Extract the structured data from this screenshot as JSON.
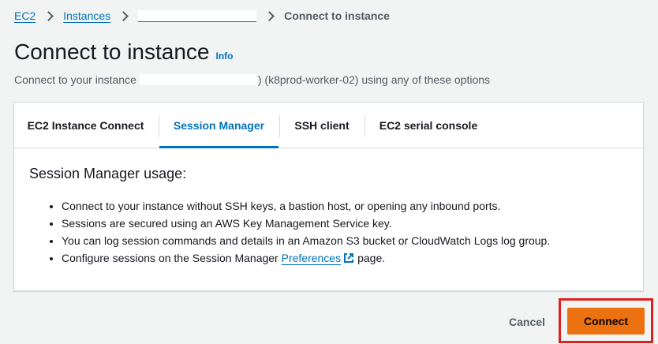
{
  "breadcrumb": {
    "items": [
      "EC2",
      "Instances"
    ],
    "current": "Connect to instance"
  },
  "header": {
    "title": "Connect to instance",
    "info": "Info",
    "subtitle_prefix": "Connect to your instance",
    "subtitle_suffix": ") (k8prod-worker-02) using any of these options"
  },
  "tabs": [
    {
      "label": "EC2 Instance Connect"
    },
    {
      "label": "Session Manager"
    },
    {
      "label": "SSH client"
    },
    {
      "label": "EC2 serial console"
    }
  ],
  "active_tab": "Session Manager",
  "panel": {
    "heading": "Session Manager usage:",
    "bullets": [
      "Connect to your instance without SSH keys, a bastion host, or opening any inbound ports.",
      "Sessions are secured using an AWS Key Management Service key.",
      "You can log session commands and details in an Amazon S3 bucket or CloudWatch Logs log group."
    ],
    "last_bullet": {
      "prefix": "Configure sessions on the Session Manager",
      "link": "Preferences",
      "suffix": "page."
    }
  },
  "footer": {
    "cancel": "Cancel",
    "connect": "Connect"
  },
  "colors": {
    "link": "#0073bb",
    "primary_button": "#ec7211",
    "highlight": "#e02020",
    "background": "#f2f3f3"
  }
}
